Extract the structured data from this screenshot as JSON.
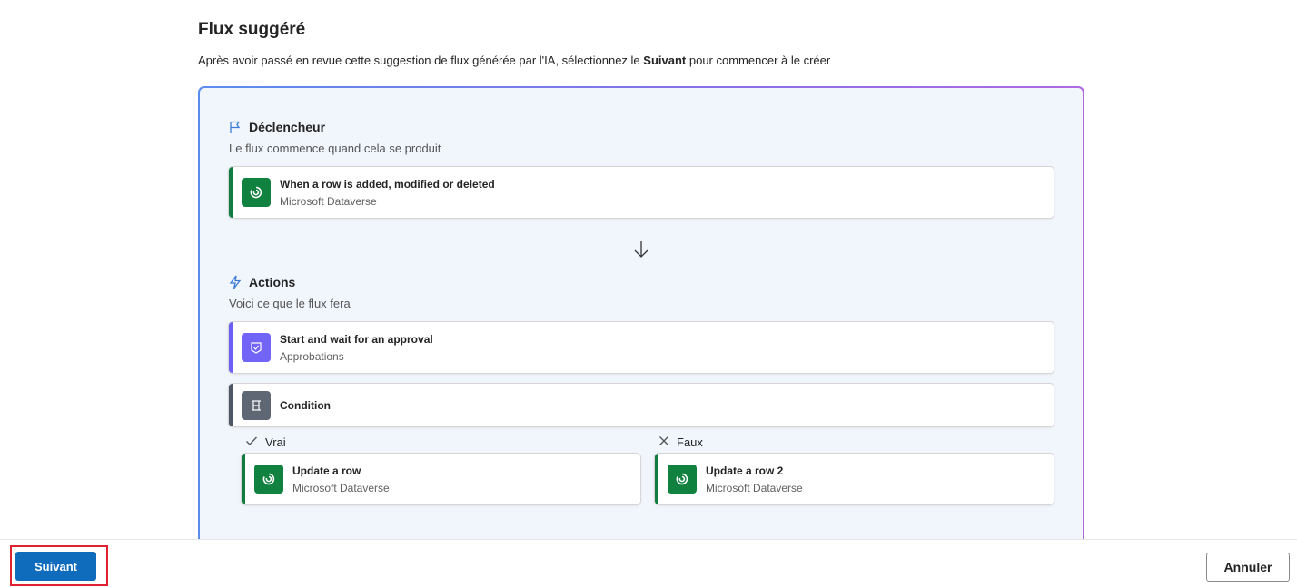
{
  "header": {
    "title": "Flux suggéré",
    "description_prefix": "Après avoir passé en revue cette suggestion de flux générée par l'IA, sélectionnez le ",
    "description_bold": "Suivant",
    "description_suffix": " pour commencer à le créer"
  },
  "trigger": {
    "heading": "Déclencheur",
    "subheading": "Le flux commence quand cela se produit",
    "icon": "flag-icon",
    "card": {
      "title": "When a row is added, modified or deleted",
      "connector": "Microsoft Dataverse",
      "icon": "dataverse-icon"
    }
  },
  "actions": {
    "heading": "Actions",
    "subheading": "Voici ce que le flux fera",
    "icon": "lightning-icon",
    "approval": {
      "title": "Start and wait for an approval",
      "connector": "Approbations",
      "icon": "approval-icon"
    },
    "condition": {
      "title": "Condition",
      "icon": "condition-icon"
    },
    "true_branch": {
      "label": "Vrai",
      "icon": "check-icon",
      "card": {
        "title": "Update a row",
        "connector": "Microsoft Dataverse",
        "icon": "dataverse-icon"
      }
    },
    "false_branch": {
      "label": "Faux",
      "icon": "close-icon",
      "card": {
        "title": "Update a row 2",
        "connector": "Microsoft Dataverse",
        "icon": "dataverse-icon"
      }
    }
  },
  "footer": {
    "next_label": "Suivant",
    "cancel_label": "Annuler"
  },
  "colors": {
    "primary": "#0f6cbd",
    "dataverse": "#10813f",
    "approvals": "#7264f7",
    "condition": "#5f6775",
    "highlight": "#e0222e",
    "frame_start": "#5b8def",
    "frame_end": "#b06ae0"
  }
}
